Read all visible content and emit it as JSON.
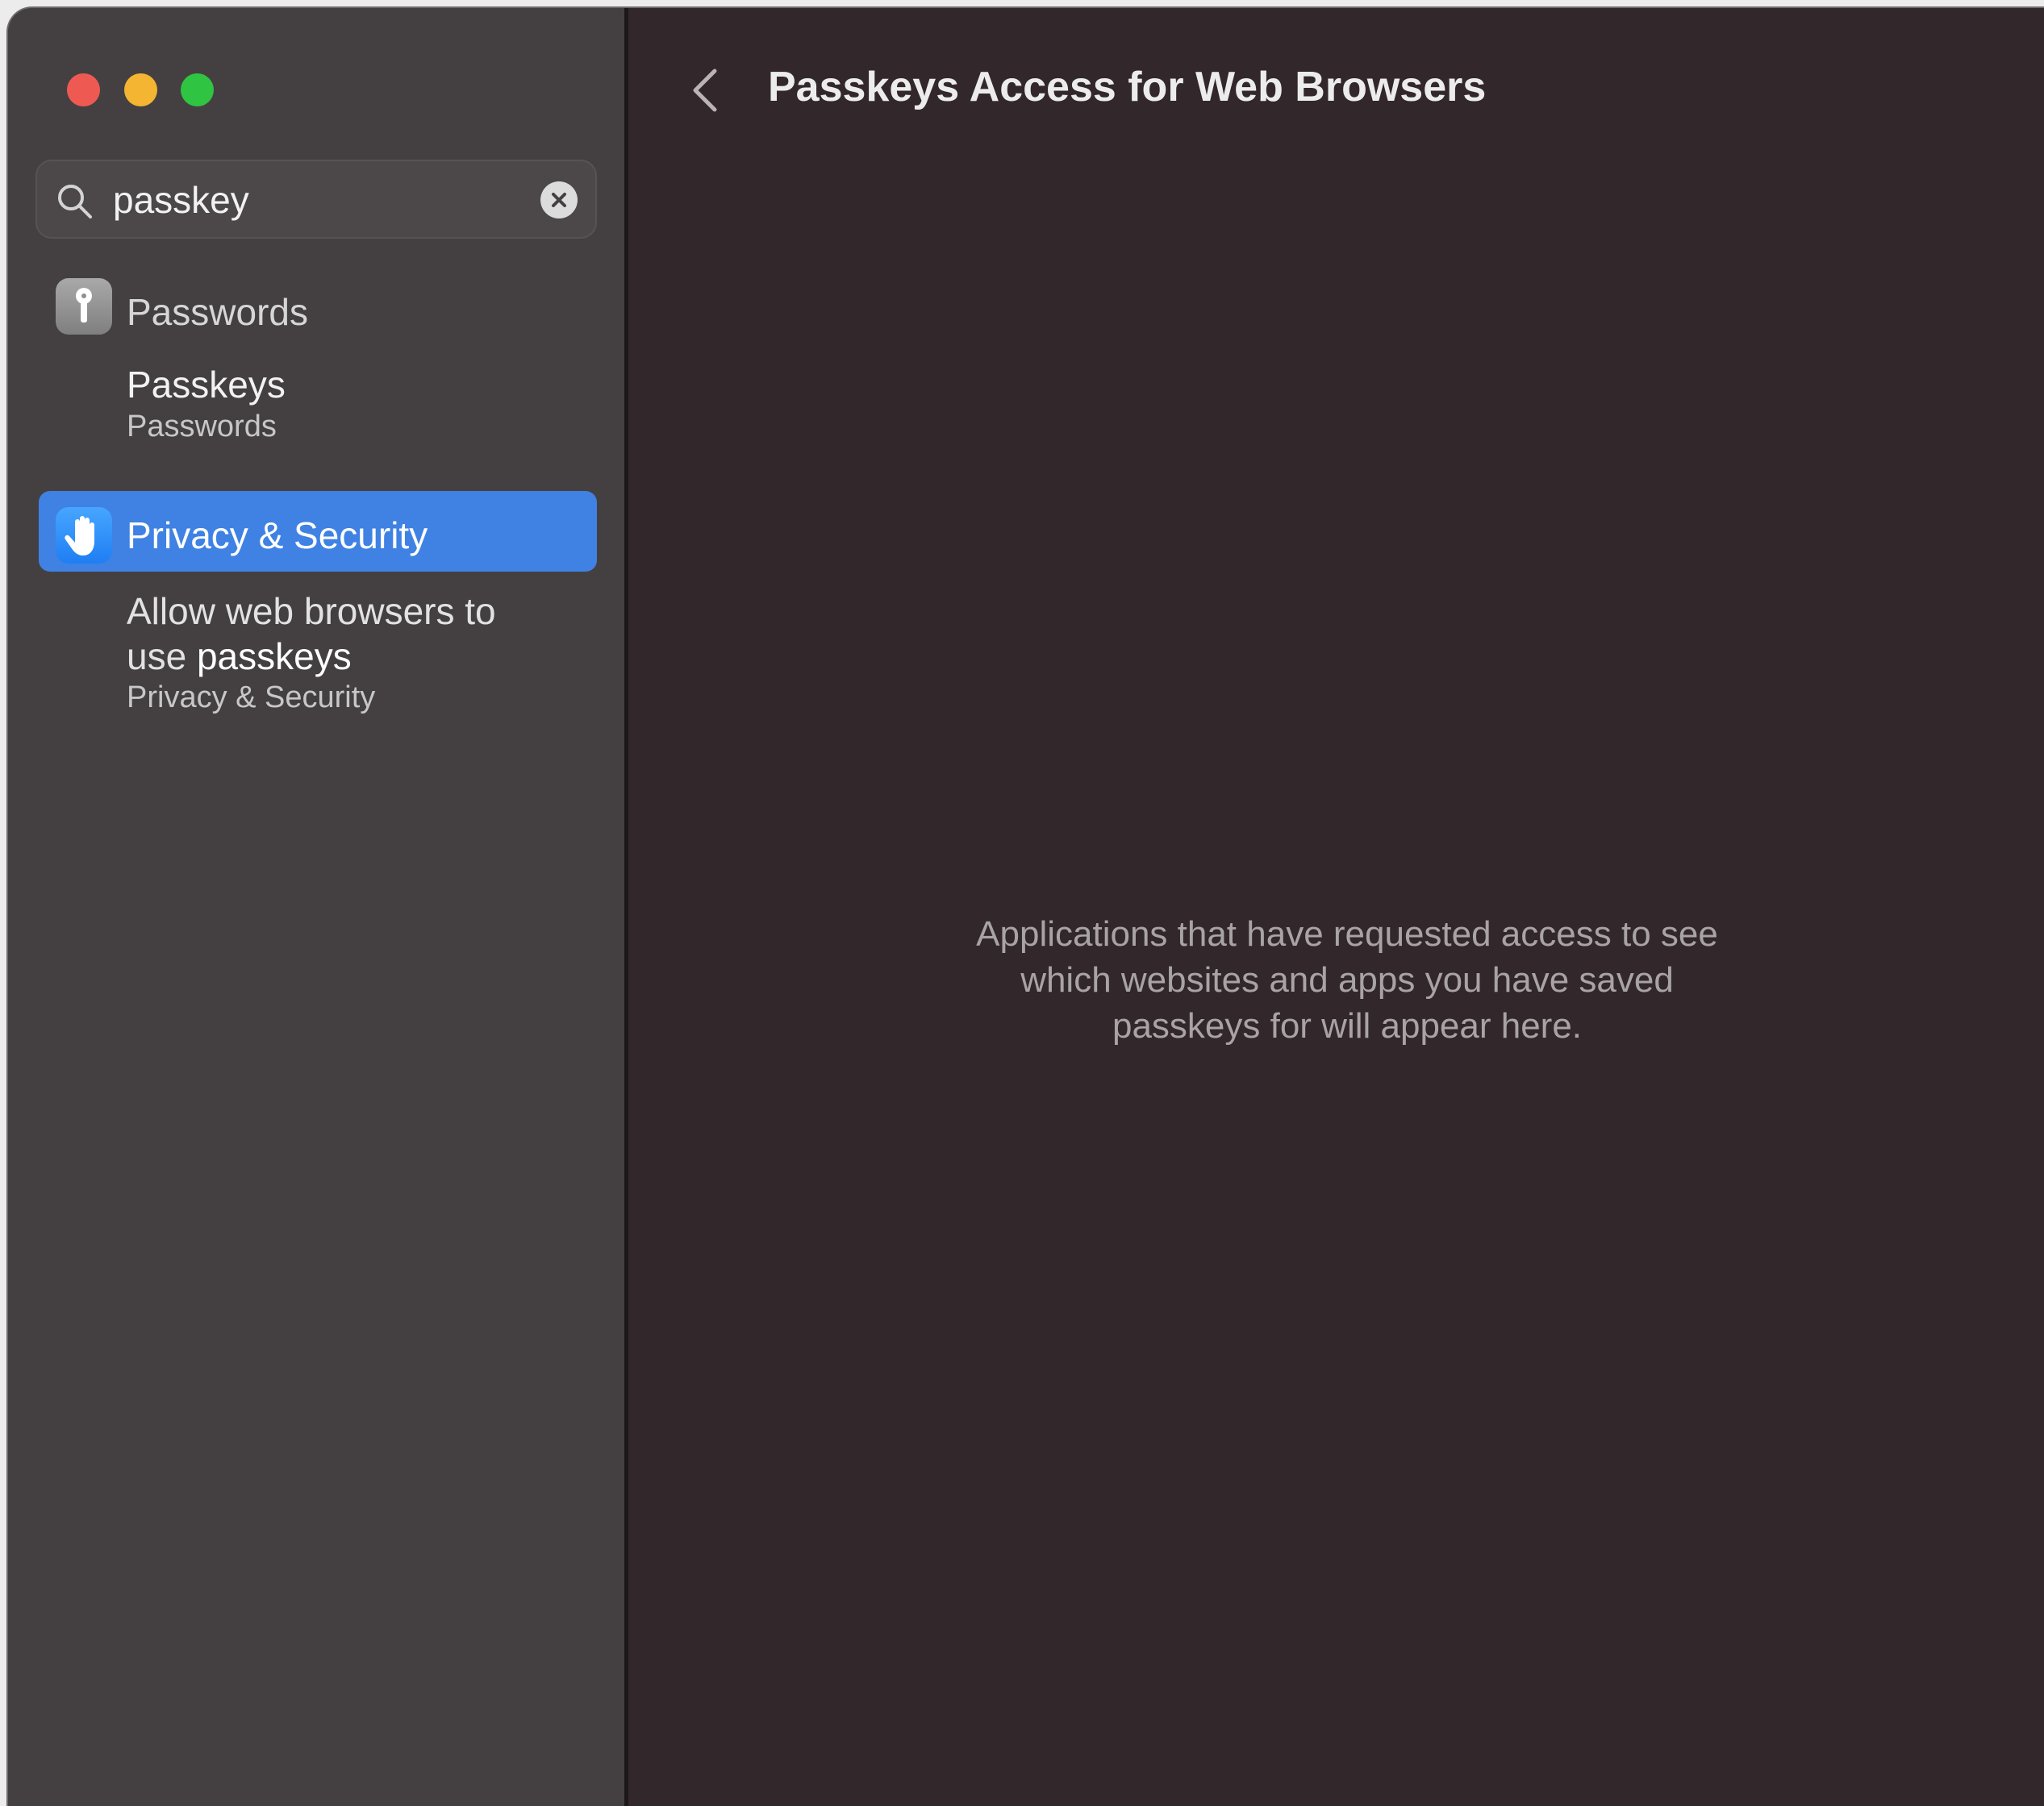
{
  "window": {
    "controls": [
      "close",
      "minimize",
      "zoom"
    ]
  },
  "search": {
    "value": "passkey",
    "icon": "search-icon",
    "clear_icon": "clear-icon"
  },
  "sidebar": {
    "results": [
      {
        "section": "Passwords",
        "icon": "key-icon",
        "items": [
          {
            "title": "Passkeys",
            "subtitle": "Passwords"
          }
        ]
      },
      {
        "section": "Privacy & Security",
        "icon": "hand-icon",
        "selected": true,
        "items": [
          {
            "title_prefix": "Allow web browsers to",
            "title_middle": "use ",
            "title_highlight": "passkeys",
            "subtitle": "Privacy & Security"
          }
        ]
      }
    ]
  },
  "content": {
    "title": "Passkeys Access for Web Browsers",
    "empty_state_line1": "Applications that have requested access to see",
    "empty_state_line2": "which websites and apps you have saved",
    "empty_state_line3": "passkeys for will appear here."
  },
  "colors": {
    "sidebar_bg": "#444041",
    "content_bg": "#32272a",
    "selection": "#3f82e3",
    "close": "#ee5a52",
    "minimize": "#f3b532",
    "zoom": "#2fc441"
  }
}
